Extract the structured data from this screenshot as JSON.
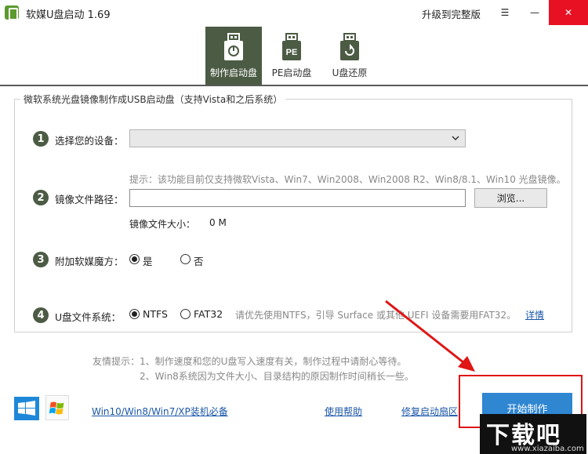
{
  "titlebar": {
    "title": "软媒U盘启动 1.69",
    "upgrade": "升级到完整版",
    "menu_glyph": "☰",
    "minimize_glyph": "—",
    "close_glyph": "✕"
  },
  "tabs": [
    {
      "label": "制作启动盘",
      "icon": "usb-power-icon",
      "active": true
    },
    {
      "label": "PE启动盘",
      "icon_text": "PE",
      "icon": "usb-pe-icon",
      "active": false
    },
    {
      "label": "U盘还原",
      "icon": "usb-restore-icon",
      "active": false
    }
  ],
  "group": {
    "legend": "微软系统光盘镜像制作成USB启动盘（支持Vista和之后系统）"
  },
  "steps": {
    "device": {
      "num": "1",
      "label": "选择您的设备：",
      "value": ""
    },
    "image": {
      "num": "2",
      "label": "镜像文件路径：",
      "hint": "提示：该功能目前仅支持微软Vista、Win7、Win2008、Win2008 R2、Win8/8.1、Win10 光盘镜像。",
      "value": "",
      "browse": "浏览...",
      "size_label": "镜像文件大小：",
      "size_value": "0 M"
    },
    "magic": {
      "num": "3",
      "label": "附加软媒魔方：",
      "yes": "是",
      "no": "否",
      "selected": "yes"
    },
    "fs": {
      "num": "4",
      "label": "U盘文件系统：",
      "ntfs": "NTFS",
      "fat32": "FAT32",
      "selected": "NTFS",
      "note": "请优先使用NTFS，引导 Surface 或其他 UEFI 设备需要用FAT32。",
      "detail": "详情"
    }
  },
  "tips": {
    "line1": "友情提示：1、制作速度和您的U盘写入速度有关，制作过程中请耐心等待。",
    "line2": "2、Win8系统因为文件大小、目录结构的原因制作时间稍长一些。"
  },
  "footer": {
    "link_install": "Win10/Win8/Win7/XP装机必备",
    "link_help": "使用帮助",
    "link_repair": "修复启动扇区",
    "start": "开始制作"
  },
  "watermark": {
    "title": "下载吧",
    "url": "www.xiazaiba.com"
  },
  "colors": {
    "accent_dark": "#4c5b44",
    "primary_blue": "#2f86d1",
    "link": "#1a56a8",
    "annotation_red": "#e01515"
  }
}
